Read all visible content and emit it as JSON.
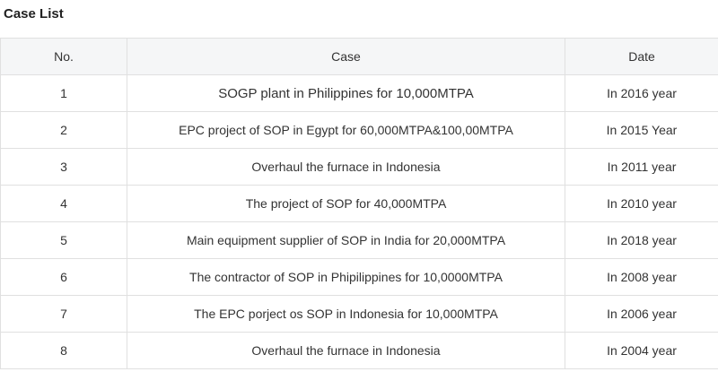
{
  "page_title": "Case List",
  "table": {
    "headers": {
      "no": "No.",
      "case": "Case",
      "date": "Date"
    },
    "rows": [
      {
        "no": "1",
        "case": "SOGP plant in Philippines for 10,000MTPA",
        "date": "In 2016 year"
      },
      {
        "no": "2",
        "case": "EPC project of SOP in Egypt for 60,000MTPA&100,00MTPA",
        "date": "In 2015 Year"
      },
      {
        "no": "3",
        "case": "Overhaul the furnace in Indonesia",
        "date": "In 2011 year"
      },
      {
        "no": "4",
        "case": "The project of SOP for 40,000MTPA",
        "date": "In 2010 year"
      },
      {
        "no": "5",
        "case": "Main equipment supplier of SOP in India for 20,000MTPA",
        "date": "In 2018 year"
      },
      {
        "no": "6",
        "case": "The contractor of SOP in Phipilippines for 10,0000MTPA",
        "date": "In 2008 year"
      },
      {
        "no": "7",
        "case": "The EPC porject os SOP in Indonesia for 10,000MTPA",
        "date": "In 2006 year"
      },
      {
        "no": "8",
        "case": "Overhaul the furnace in Indonesia",
        "date": "In 2004 year"
      }
    ]
  },
  "colors": {
    "header_background": "#f5f6f7",
    "border": "#e0e0e0",
    "text": "#333333"
  }
}
